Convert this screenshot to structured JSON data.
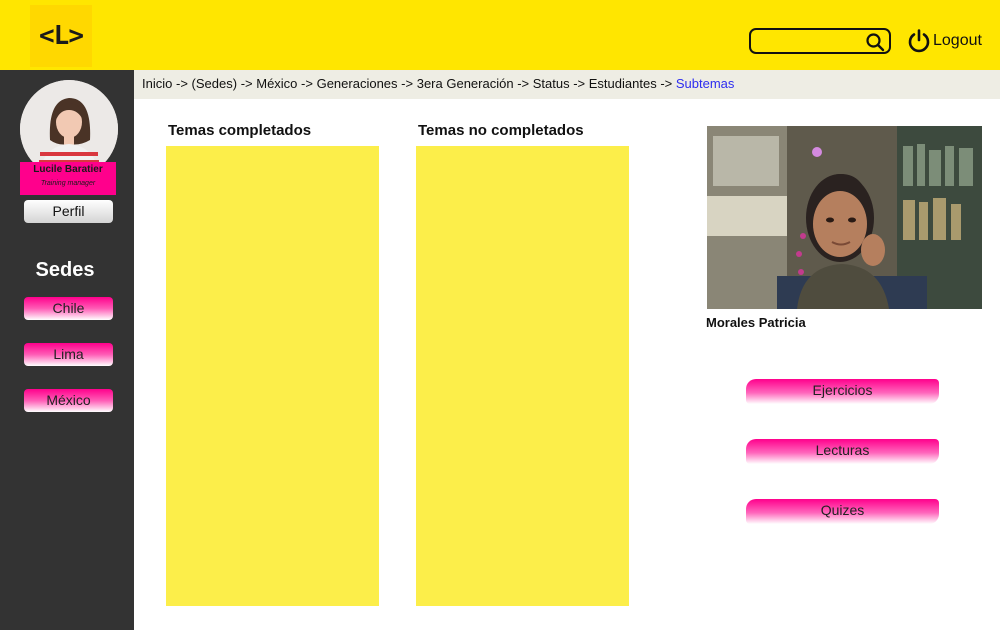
{
  "header": {
    "logo_text": "<L>",
    "search": {
      "value": "",
      "placeholder": ""
    },
    "logout_label": "Logout"
  },
  "sidebar": {
    "profile": {
      "name": "Lucile Baratier",
      "role": "Training manager",
      "profile_button": "Perfil"
    },
    "sedes_title": "Sedes",
    "sedes": [
      {
        "label": "Chile"
      },
      {
        "label": "Lima"
      },
      {
        "label": "México"
      }
    ]
  },
  "breadcrumb": {
    "items": [
      "Inicio",
      "(Sedes)",
      "México",
      "Generaciones",
      "3era Generación",
      "Status",
      "Estudiantes"
    ],
    "separator": "->",
    "current": "Subtemas"
  },
  "main": {
    "completed_title": "Temas completados",
    "not_completed_title": "Temas no completados"
  },
  "student": {
    "name": "Morales Patricia",
    "actions": [
      {
        "label": "Ejercicios"
      },
      {
        "label": "Lecturas"
      },
      {
        "label": "Quizes"
      }
    ]
  },
  "colors": {
    "header_yellow": "#ffe600",
    "sidebar_dark": "#333333",
    "accent_pink": "#ff008c",
    "panel_yellow": "#fcee4a",
    "breadcrumb_bg": "#eeede4",
    "link_blue": "#2d2df0"
  }
}
